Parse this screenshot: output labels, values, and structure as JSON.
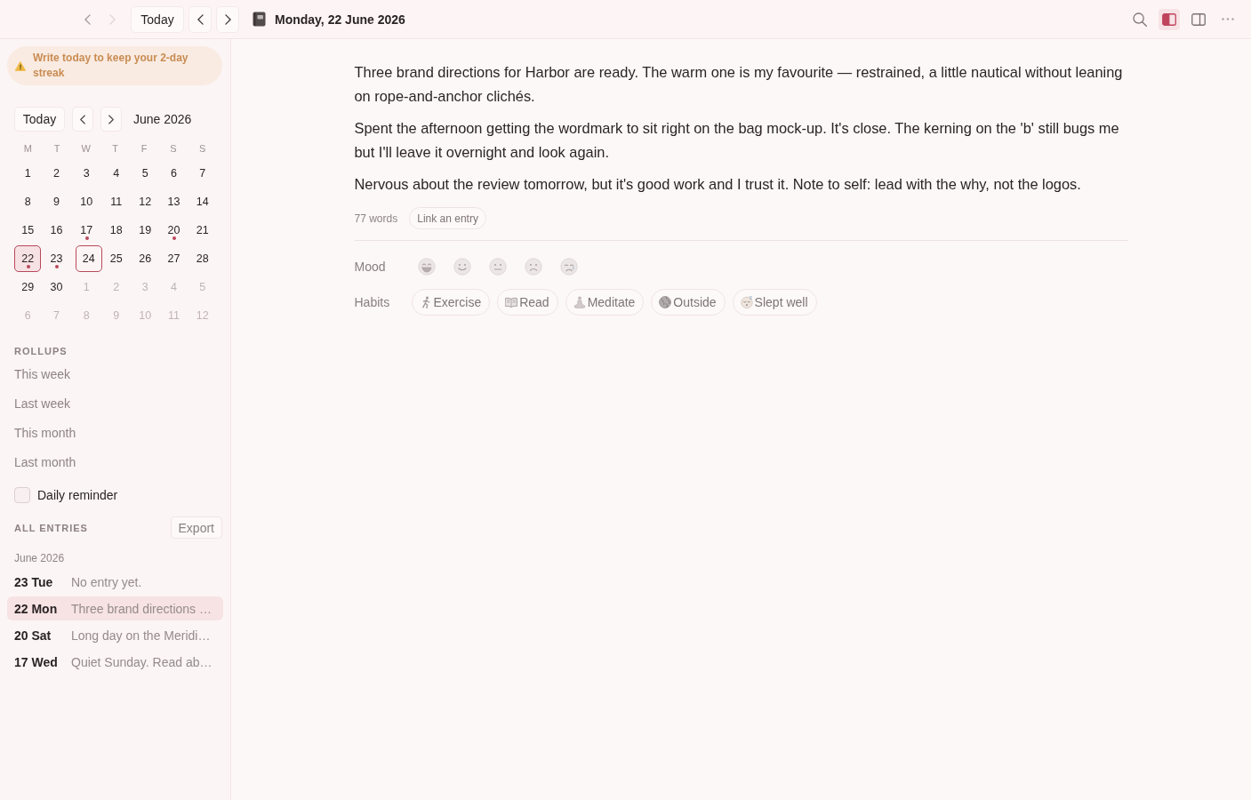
{
  "topbar": {
    "history": [
      {
        "kind": "back",
        "disabled": false
      },
      {
        "kind": "forward",
        "disabled": true
      }
    ],
    "today_button": "Today",
    "title": "Monday, 22 June 2026",
    "tools": [
      {
        "kind": "search",
        "on": false
      },
      {
        "kind": "left_sidebar",
        "on": true
      },
      {
        "kind": "right_sidebar",
        "on": false
      },
      {
        "kind": "more",
        "on": false
      }
    ]
  },
  "sidebar": {
    "streak_banner": "Write today to keep your 2-day streak",
    "calendar": {
      "today_button": "Today",
      "month": "June 2026",
      "weekdays": [
        "M",
        "T",
        "W",
        "T",
        "F",
        "S",
        "S"
      ],
      "days": [
        {
          "label": "1",
          "outside": false,
          "selected": false,
          "today": false,
          "has_entry": false
        },
        {
          "label": "2",
          "outside": false,
          "selected": false,
          "today": false,
          "has_entry": false
        },
        {
          "label": "3",
          "outside": false,
          "selected": false,
          "today": false,
          "has_entry": false
        },
        {
          "label": "4",
          "outside": false,
          "selected": false,
          "today": false,
          "has_entry": false
        },
        {
          "label": "5",
          "outside": false,
          "selected": false,
          "today": false,
          "has_entry": false
        },
        {
          "label": "6",
          "outside": false,
          "selected": false,
          "today": false,
          "has_entry": false
        },
        {
          "label": "7",
          "outside": false,
          "selected": false,
          "today": false,
          "has_entry": false
        },
        {
          "label": "8",
          "outside": false,
          "selected": false,
          "today": false,
          "has_entry": false
        },
        {
          "label": "9",
          "outside": false,
          "selected": false,
          "today": false,
          "has_entry": false
        },
        {
          "label": "10",
          "outside": false,
          "selected": false,
          "today": false,
          "has_entry": false
        },
        {
          "label": "11",
          "outside": false,
          "selected": false,
          "today": false,
          "has_entry": false
        },
        {
          "label": "12",
          "outside": false,
          "selected": false,
          "today": false,
          "has_entry": false
        },
        {
          "label": "13",
          "outside": false,
          "selected": false,
          "today": false,
          "has_entry": false
        },
        {
          "label": "14",
          "outside": false,
          "selected": false,
          "today": false,
          "has_entry": false
        },
        {
          "label": "15",
          "outside": false,
          "selected": false,
          "today": false,
          "has_entry": false
        },
        {
          "label": "16",
          "outside": false,
          "selected": false,
          "today": false,
          "has_entry": false
        },
        {
          "label": "17",
          "outside": false,
          "selected": false,
          "today": false,
          "has_entry": true
        },
        {
          "label": "18",
          "outside": false,
          "selected": false,
          "today": false,
          "has_entry": false
        },
        {
          "label": "19",
          "outside": false,
          "selected": false,
          "today": false,
          "has_entry": false
        },
        {
          "label": "20",
          "outside": false,
          "selected": false,
          "today": false,
          "has_entry": true
        },
        {
          "label": "21",
          "outside": false,
          "selected": false,
          "today": false,
          "has_entry": false
        },
        {
          "label": "22",
          "outside": false,
          "selected": true,
          "today": false,
          "has_entry": true
        },
        {
          "label": "23",
          "outside": false,
          "selected": false,
          "today": false,
          "has_entry": true
        },
        {
          "label": "24",
          "outside": false,
          "selected": false,
          "today": true,
          "has_entry": false
        },
        {
          "label": "25",
          "outside": false,
          "selected": false,
          "today": false,
          "has_entry": false
        },
        {
          "label": "26",
          "outside": false,
          "selected": false,
          "today": false,
          "has_entry": false
        },
        {
          "label": "27",
          "outside": false,
          "selected": false,
          "today": false,
          "has_entry": false
        },
        {
          "label": "28",
          "outside": false,
          "selected": false,
          "today": false,
          "has_entry": false
        },
        {
          "label": "29",
          "outside": false,
          "selected": false,
          "today": false,
          "has_entry": false
        },
        {
          "label": "30",
          "outside": false,
          "selected": false,
          "today": false,
          "has_entry": false
        },
        {
          "label": "1",
          "outside": true,
          "selected": false,
          "today": false,
          "has_entry": false
        },
        {
          "label": "2",
          "outside": true,
          "selected": false,
          "today": false,
          "has_entry": false
        },
        {
          "label": "3",
          "outside": true,
          "selected": false,
          "today": false,
          "has_entry": false
        },
        {
          "label": "4",
          "outside": true,
          "selected": false,
          "today": false,
          "has_entry": false
        },
        {
          "label": "5",
          "outside": true,
          "selected": false,
          "today": false,
          "has_entry": false
        },
        {
          "label": "6",
          "outside": true,
          "selected": false,
          "today": false,
          "has_entry": false
        },
        {
          "label": "7",
          "outside": true,
          "selected": false,
          "today": false,
          "has_entry": false
        },
        {
          "label": "8",
          "outside": true,
          "selected": false,
          "today": false,
          "has_entry": false
        },
        {
          "label": "9",
          "outside": true,
          "selected": false,
          "today": false,
          "has_entry": false
        },
        {
          "label": "10",
          "outside": true,
          "selected": false,
          "today": false,
          "has_entry": false
        },
        {
          "label": "11",
          "outside": true,
          "selected": false,
          "today": false,
          "has_entry": false
        },
        {
          "label": "12",
          "outside": true,
          "selected": false,
          "today": false,
          "has_entry": false
        }
      ]
    },
    "rollups": {
      "heading": "ROLLUPS",
      "items": [
        "This week",
        "Last week",
        "This month",
        "Last month"
      ]
    },
    "daily_reminder": {
      "label": "Daily reminder",
      "checked": false
    },
    "entries": {
      "heading": "ALL ENTRIES",
      "export_button": "Export",
      "groups": [
        {
          "month": "June 2026",
          "items": [
            {
              "date": "23 Tue",
              "preview": "No entry yet.",
              "selected": false
            },
            {
              "date": "22 Mon",
              "preview": "Three brand directions …",
              "selected": true
            },
            {
              "date": "20 Sat",
              "preview": "Long day on the Meridi…",
              "selected": false
            },
            {
              "date": "17 Wed",
              "preview": "Quiet Sunday. Read ab…",
              "selected": false
            }
          ]
        }
      ]
    }
  },
  "entry": {
    "paragraphs": [
      "Three brand directions for Harbor are ready. The warm one is my favourite — restrained, a little nautical without leaning on rope-and-anchor clichés.",
      "Spent the afternoon getting the wordmark to sit right on the bag mock-up. It's close. The kerning on the 'b' still bugs me but I'll leave it overnight and look again.",
      "Nervous about the review tomorrow, but it's good work and I trust it. Note to self: lead with the why, not the logos."
    ],
    "word_count": "77 words",
    "link_button": "Link an entry",
    "mood": {
      "label": "Mood",
      "options": [
        {
          "kind": "grinning",
          "selected": false
        },
        {
          "kind": "smiling",
          "selected": false
        },
        {
          "kind": "neutral",
          "selected": false
        },
        {
          "kind": "frowning",
          "selected": false
        },
        {
          "kind": "crying",
          "selected": false
        }
      ]
    },
    "habits": {
      "label": "Habits",
      "items": [
        {
          "kind": "exercise",
          "label": "Exercise",
          "checked": false
        },
        {
          "kind": "read",
          "label": "Read",
          "checked": false
        },
        {
          "kind": "meditate",
          "label": "Meditate",
          "checked": false
        },
        {
          "kind": "outside",
          "label": "Outside",
          "checked": false
        },
        {
          "kind": "sleep",
          "label": "Slept well",
          "checked": false
        }
      ]
    }
  }
}
